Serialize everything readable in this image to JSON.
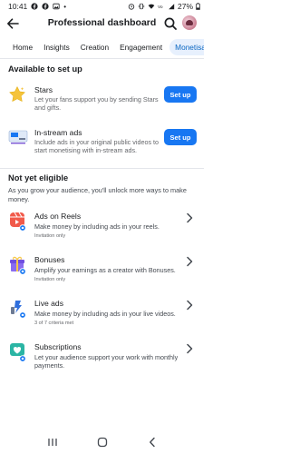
{
  "status_bar": {
    "time": "10:41",
    "battery": "27%"
  },
  "header": {
    "title": "Professional dashboard"
  },
  "tabs": [
    {
      "label": "Home"
    },
    {
      "label": "Insights"
    },
    {
      "label": "Creation"
    },
    {
      "label": "Engagement"
    },
    {
      "label": "Monetisation"
    }
  ],
  "available": {
    "title": "Available to set up",
    "items": [
      {
        "title": "Stars",
        "desc": "Let your fans support you by sending Stars and gifts.",
        "button": "Set up",
        "icon": "star-icon"
      },
      {
        "title": "In-stream ads",
        "desc": "Include ads in your original public videos to start monetising with in-stream ads.",
        "button": "Set up",
        "icon": "video-ads-icon"
      }
    ]
  },
  "not_eligible": {
    "title": "Not yet eligible",
    "desc": "As you grow your audience, you'll unlock more ways to make money.",
    "items": [
      {
        "title": "Ads on Reels",
        "desc": "Make money by including ads in your reels.",
        "sub": "Invitation only",
        "icon": "reels-ads-icon"
      },
      {
        "title": "Bonuses",
        "desc": "Amplify your earnings as a creator with Bonuses.",
        "sub": "Invitation only",
        "icon": "gift-icon"
      },
      {
        "title": "Live ads",
        "desc": "Make money by including ads in your live videos.",
        "sub": "3 of 7 criteria met",
        "icon": "live-ads-icon"
      },
      {
        "title": "Subscriptions",
        "desc": "Let your audience support your work with monthly payments.",
        "sub": "",
        "icon": "subscription-icon"
      }
    ]
  },
  "colors": {
    "accent": "#1877f2",
    "tab_active_bg": "#e7f0fd",
    "tab_active_text": "#0a66c2"
  }
}
